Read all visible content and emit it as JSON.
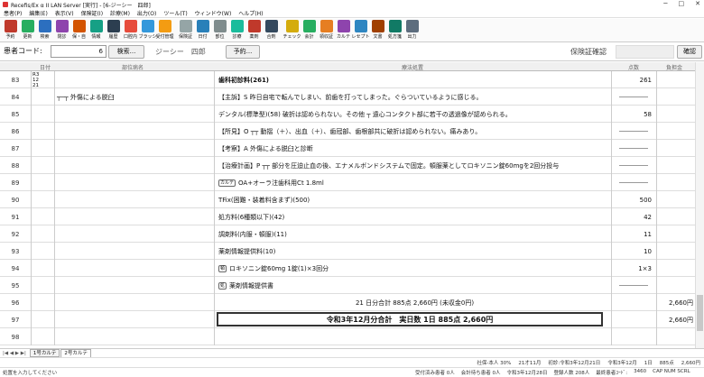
{
  "window": {
    "title": "Recefis/Ex α II  LAN Server [実行] - [6-ジーシー　四郎]"
  },
  "menu": [
    "患者(P)",
    "編集(E)",
    "表示(V)",
    "保険証(I)",
    "診療(M)",
    "出力(O)",
    "ツール(T)",
    "ウィンドウ(W)",
    "ヘルプ(H)"
  ],
  "toolbar": [
    {
      "label": "予約",
      "color": "#c0392b"
    },
    {
      "label": "更新",
      "color": "#27ae60"
    },
    {
      "label": "検索",
      "color": "#2c6fbf"
    },
    {
      "label": "閉診",
      "color": "#8e44ad"
    },
    {
      "label": "保・自",
      "color": "#d35400"
    },
    {
      "label": "情報",
      "color": "#16a085"
    },
    {
      "label": "履歴",
      "color": "#2c3e50"
    },
    {
      "label": "口腔内",
      "color": "#e74c3c"
    },
    {
      "label": "ブラッシ",
      "color": "#3498db"
    },
    {
      "label": "受付管理",
      "color": "#f39c12"
    },
    {
      "label": "保険証",
      "color": "#95a5a6"
    },
    {
      "label": "日付",
      "color": "#2980b9"
    },
    {
      "label": "部位",
      "color": "#7f8c8d"
    },
    {
      "label": "診療",
      "color": "#1abc9c"
    },
    {
      "label": "薬剤",
      "color": "#c0392b"
    },
    {
      "label": "合剤",
      "color": "#34495e"
    },
    {
      "label": "チェック",
      "color": "#d4ac0d"
    },
    {
      "label": "会計",
      "color": "#27ae60"
    },
    {
      "label": "領収証",
      "color": "#e67e22"
    },
    {
      "label": "カルテ",
      "color": "#8e44ad"
    },
    {
      "label": "レセプト",
      "color": "#2e86c1"
    },
    {
      "label": "文書",
      "color": "#a04000"
    },
    {
      "label": "処方箋",
      "color": "#117a65"
    },
    {
      "label": "出力",
      "color": "#5d6d7e"
    }
  ],
  "patient": {
    "code_label": "患者コード:",
    "code_value": "6",
    "search_btn": "検索...",
    "name": "ジーシー　四郎",
    "reserve_btn": "予約...",
    "insurance_label": "保険証確認",
    "confirm_btn": "確認"
  },
  "headers": {
    "date": "日付",
    "part": "部位病名",
    "treatment": "療法処置",
    "points": "点数",
    "fee": "負担金"
  },
  "rows": [
    {
      "no": "83",
      "date": "R3\n12\n21",
      "part": "",
      "treat": "歯科初診料(261)",
      "bold": true,
      "pts": "261",
      "fee": ""
    },
    {
      "no": "84",
      "date": "",
      "part": "┬─┬ 外傷による脱臼",
      "treat": "【主訴】S 昨日自宅で転んでしまい、前歯を打ってしまった。ぐらついているように感じる。",
      "pts": "dash",
      "fee": ""
    },
    {
      "no": "85",
      "date": "",
      "part": "",
      "treat": "デンタル(標準型)(58) 破折は認められない。その他 ┬ 遠心コンタクト部に若干の透過像が認められる。",
      "pts": "58",
      "fee": ""
    },
    {
      "no": "86",
      "date": "",
      "part": "",
      "treat": "【所見】O ┬┬ 動揺（＋）、出血（＋）、歯冠部、歯根部共に破折は認められない。痛みあり。",
      "pts": "dash",
      "fee": ""
    },
    {
      "no": "87",
      "date": "",
      "part": "",
      "treat": "【考察】A 外傷による脱臼と診断",
      "pts": "dash",
      "fee": ""
    },
    {
      "no": "88",
      "date": "",
      "part": "",
      "treat": "【治療計画】P ┬┬ 部分を圧迫止血の後、エナメルボンドシステムで固定。頓服薬としてロキソニン錠60mgを2回分投与",
      "pts": "dash",
      "fee": ""
    },
    {
      "no": "89",
      "date": "",
      "part": "",
      "tag": "カルテ",
      "treat": "OA+オーラ注歯科用Ct 1.8ml",
      "pts": "dash",
      "fee": ""
    },
    {
      "no": "90",
      "date": "",
      "part": "",
      "treat": "TFix(困難・装着料含まず)(500)",
      "pts": "500",
      "fee": ""
    },
    {
      "no": "91",
      "date": "",
      "part": "",
      "treat": "処方料(6種類以下)(42)",
      "pts": "42",
      "fee": ""
    },
    {
      "no": "92",
      "date": "",
      "part": "",
      "treat": "調剤料(内服・頓服)(11)",
      "pts": "11",
      "fee": ""
    },
    {
      "no": "93",
      "date": "",
      "part": "",
      "treat": "薬剤情報提供料(10)",
      "pts": "10",
      "fee": ""
    },
    {
      "no": "94",
      "date": "",
      "part": "",
      "tag": "頓",
      "treat": "ロキソニン錠60mg 1錠(1)×3回分",
      "pts": "1×3",
      "fee": ""
    },
    {
      "no": "95",
      "date": "",
      "part": "",
      "tag": "処",
      "treat": "薬剤情報提供書",
      "pts": "dash",
      "fee": ""
    },
    {
      "no": "96",
      "date": "",
      "part": "",
      "treat": "21 日分合計 885点 2,660円 (未収金0円)",
      "center": true,
      "pts": "",
      "fee": "2,660円"
    },
    {
      "no": "97",
      "date": "",
      "part": "",
      "treat": "令和3年12月分合計　実日数 1日 885点 2,660円",
      "total": true,
      "pts": "",
      "fee": "2,660円"
    },
    {
      "no": "98",
      "date": "",
      "part": "",
      "treat": "",
      "pts": "",
      "fee": ""
    }
  ],
  "tabs": {
    "tab1": "1号カルテ",
    "tab2": "2号カルテ"
  },
  "status1": [
    "社保-本人 30%",
    "21才11月",
    "初診:令和3年12月21日",
    "令和3年12月",
    "1日",
    "885点",
    "2,660円"
  ],
  "status2": {
    "msg": "処置を入力してください",
    "items": [
      "受付済み患者 0人",
      "会計待ち患者 0人",
      "令和3年12月28日",
      "登録人数 208人",
      "最終患者ｺｰﾄﾞ:",
      "3460",
      "CAP NUM SCRL"
    ]
  }
}
